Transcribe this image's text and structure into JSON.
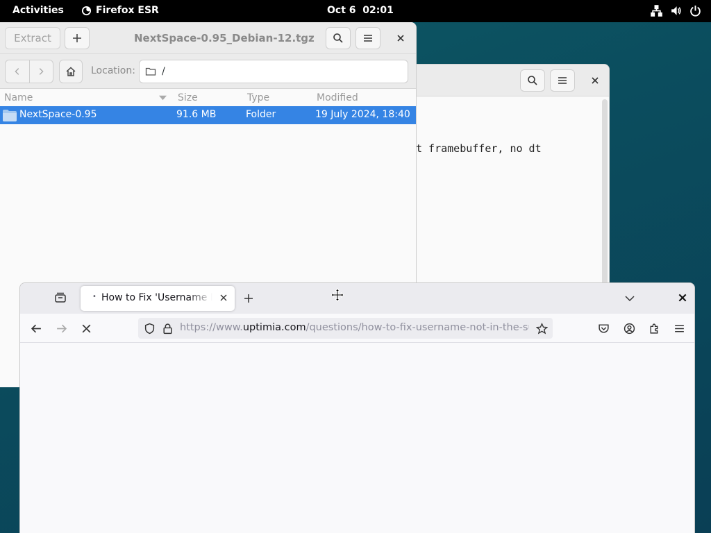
{
  "topbar": {
    "activities": "Activities",
    "app_name": "Firefox ESR",
    "clock": "Oct 6  02:01",
    "tray_icons": [
      "network-icon",
      "volume-icon",
      "power-icon"
    ]
  },
  "archive_window": {
    "extract_label": "Extract",
    "title": "NextSpace-0.95_Debian-12.tgz",
    "location_label": "Location:",
    "location_value": "/",
    "columns": {
      "name": "Name",
      "size": "Size",
      "type": "Type",
      "modified": "Modified"
    },
    "rows": [
      {
        "name": "NextSpace-0.95",
        "size": "91.6 MB",
        "type": "Folder",
        "modified": "19 July 2024, 18:40"
      }
    ],
    "selection_color": "#3584e4"
  },
  "editor_window": {
    "visible_text": "t framebuffer, no dt"
  },
  "firefox_window": {
    "tab_title": "How to Fix 'Username Not in the Sudoers File' Error",
    "url_prefix": "https://www.",
    "url_domain": "uptimia.com",
    "url_path": "/questions/how-to-fix-username-not-in-the-sudoers-file"
  }
}
